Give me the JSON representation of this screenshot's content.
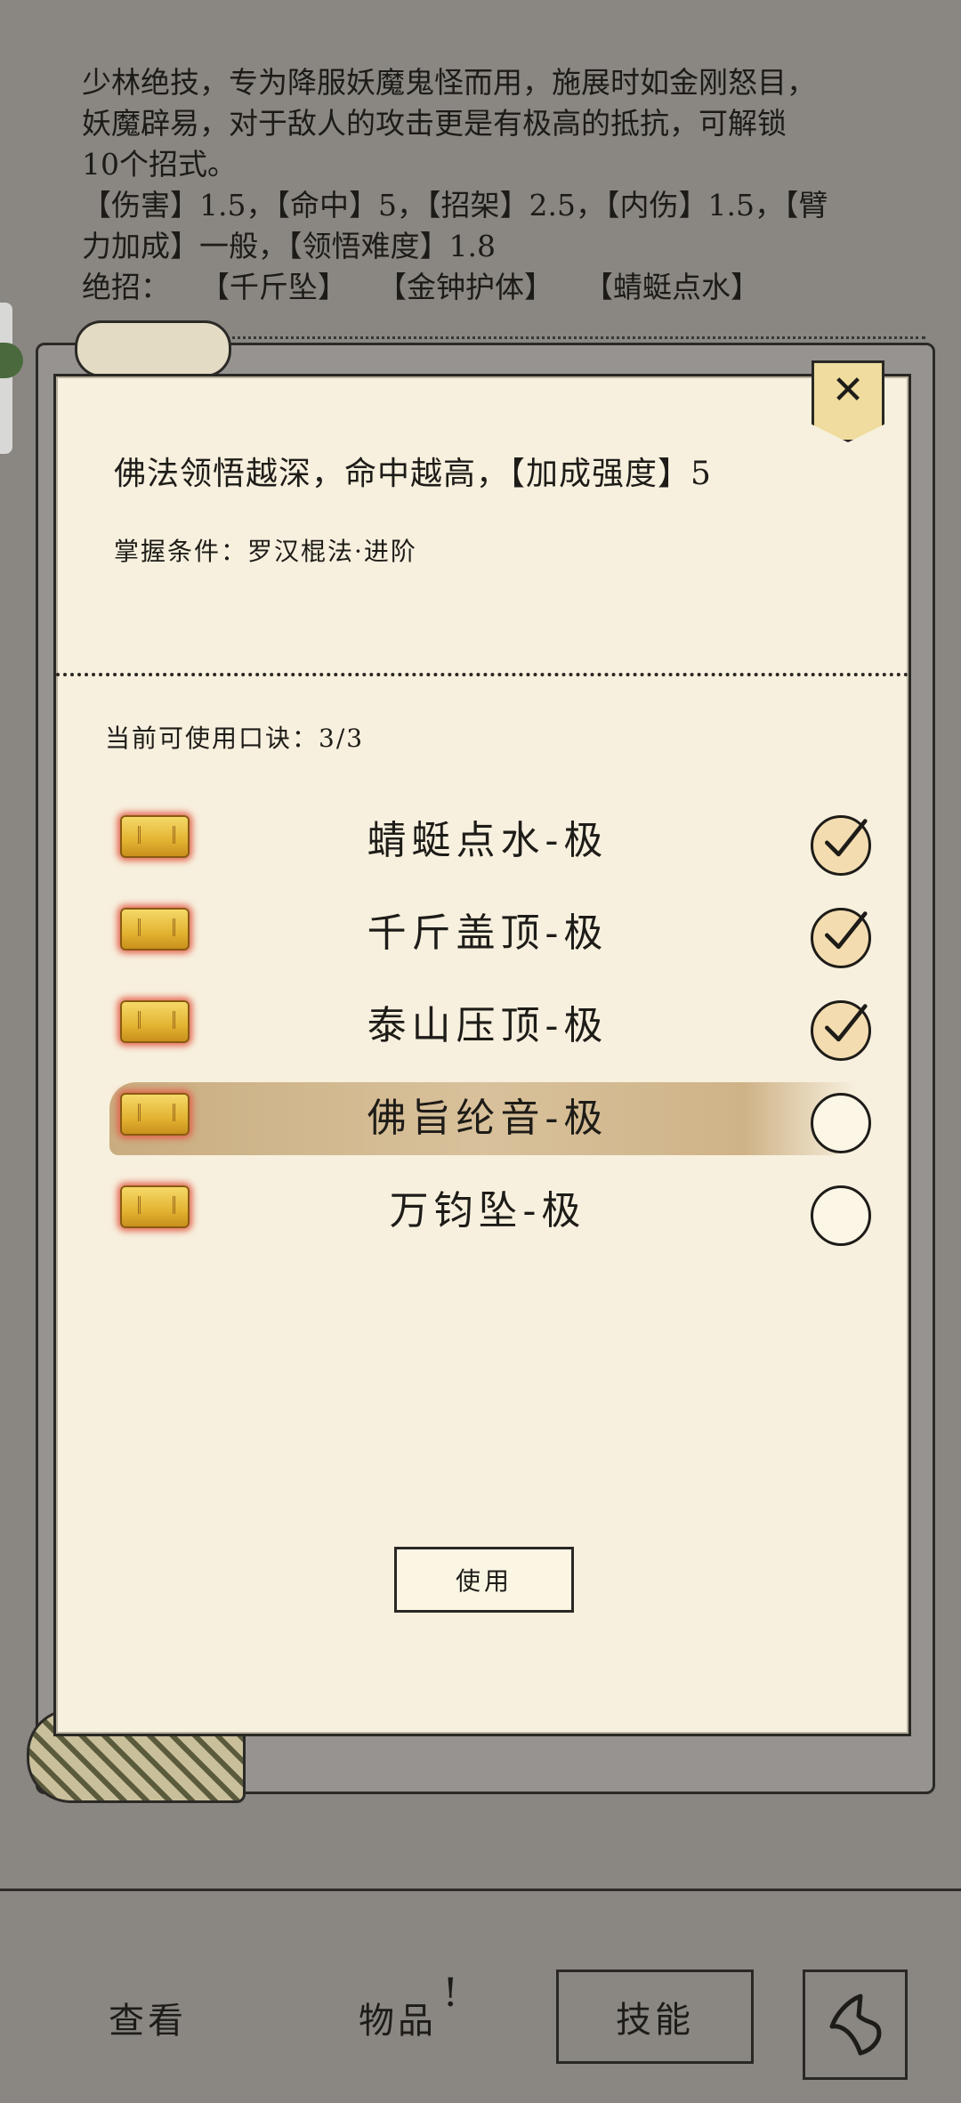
{
  "background": {
    "description_lines": [
      "少林绝技，专为降服妖魔鬼怪而用，施展时如金刚怒目，",
      "妖魔辟易，对于敌人的攻击更是有极高的抵抗，可解锁",
      "10个招式。",
      "【伤害】1.5，【命中】5，【招架】2.5，【内伤】1.5，【臂",
      "力加成】一般，【领悟难度】1.8"
    ],
    "ultimate_label": "绝招：",
    "ultimates": [
      "【千斤坠】",
      "【金钟护体】",
      "【蜻蜓点水】"
    ]
  },
  "modal": {
    "close_glyph": "✕",
    "bonus_text": "佛法领悟越深，命中越高，【加成强度】5",
    "condition_text": "掌握条件：罗汉棍法·进阶",
    "count_text": "当前可使用口诀：3/3",
    "formulas": [
      {
        "name": "蜻蜓点水-极",
        "checked": true
      },
      {
        "name": "千斤盖顶-极",
        "checked": true
      },
      {
        "name": "泰山压顶-极",
        "checked": true
      },
      {
        "name": "佛旨纶音-极",
        "checked": false,
        "selected": true
      },
      {
        "name": "万钧坠-极",
        "checked": false
      }
    ],
    "use_button": "使用"
  },
  "bottom_nav": {
    "view": "查看",
    "items": "物品",
    "items_alert": "!",
    "skills": "技能"
  },
  "colors": {
    "paper": "#f7f0de",
    "backdrop": "#8a8782",
    "selected_highlight": "#c9ad80",
    "token_gold": "#e3b332",
    "token_glow": "#e2604a"
  }
}
